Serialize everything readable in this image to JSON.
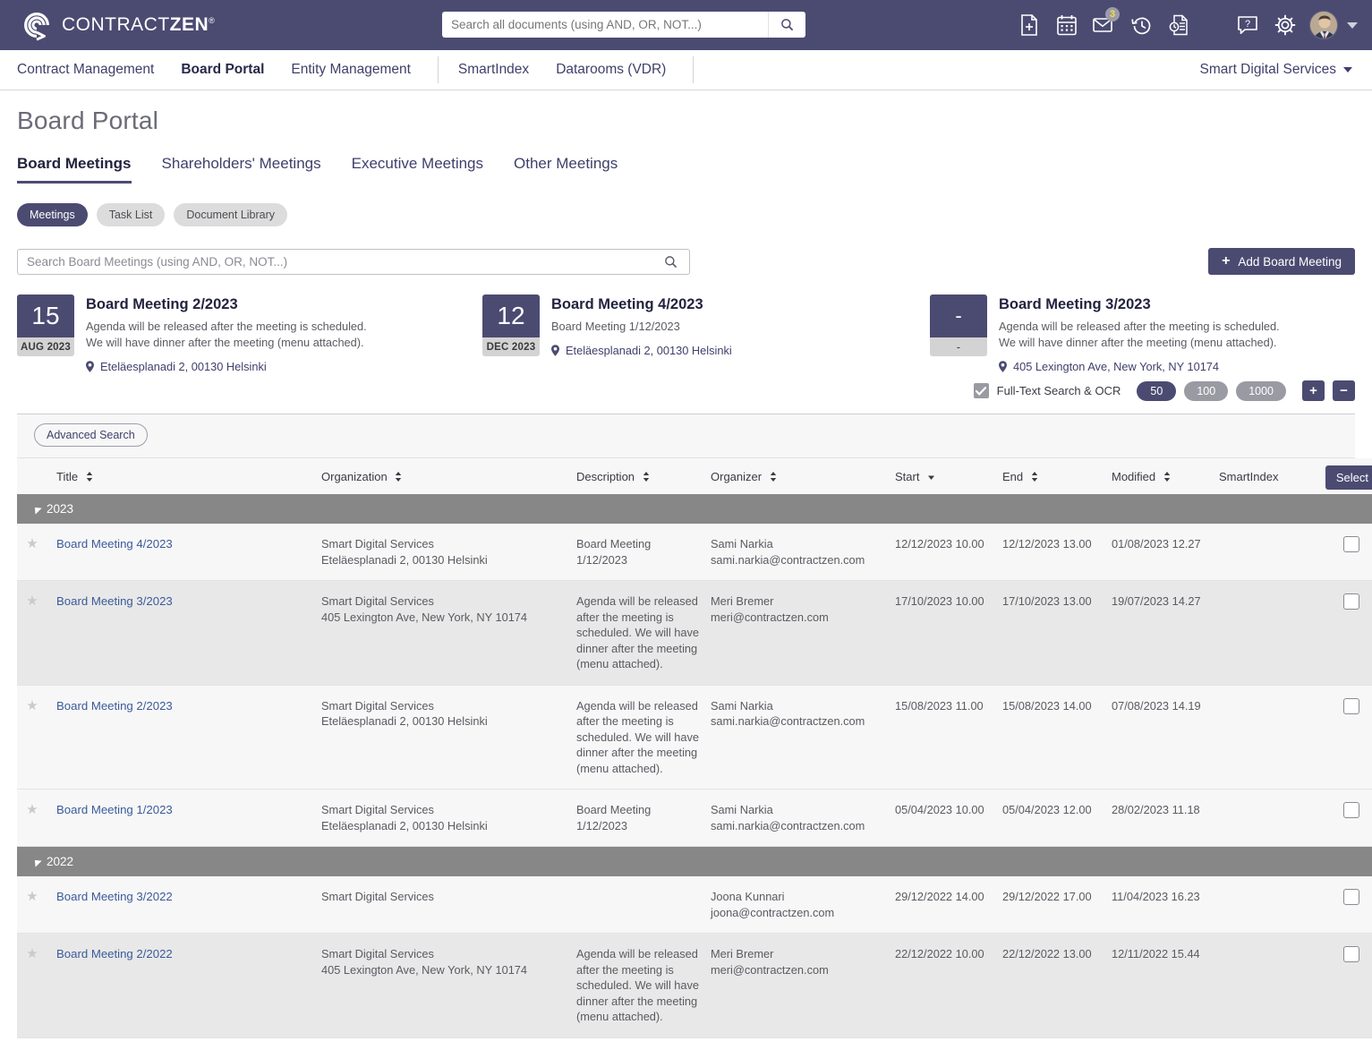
{
  "topbar": {
    "brand": "CONTRACT",
    "brand_bold": "ZEN",
    "brand_mark": "®",
    "search_placeholder": "Search all documents (using AND, OR, NOT...)",
    "search_value": "",
    "mail_badge": "3",
    "icons": [
      "add-document-icon",
      "calendar-icon",
      "mail-icon",
      "history-icon",
      "document-history-icon",
      "help-icon",
      "settings-icon",
      "avatar"
    ]
  },
  "nav": {
    "items": [
      {
        "label": "Contract Management",
        "active": false
      },
      {
        "label": "Board Portal",
        "active": true
      },
      {
        "label": "Entity Management",
        "active": false
      },
      {
        "label": "SmartIndex",
        "active": false
      },
      {
        "label": "Datarooms (VDR)",
        "active": false
      }
    ],
    "organization": "Smart Digital Services"
  },
  "page": {
    "title": "Board Portal",
    "tabs": [
      {
        "label": "Board Meetings",
        "active": true
      },
      {
        "label": "Shareholders' Meetings",
        "active": false
      },
      {
        "label": "Executive Meetings",
        "active": false
      },
      {
        "label": "Other Meetings",
        "active": false
      }
    ],
    "pills": [
      {
        "label": "Meetings",
        "active": true
      },
      {
        "label": "Task List",
        "active": false
      },
      {
        "label": "Document Library",
        "active": false
      }
    ],
    "search_placeholder": "Search Board Meetings (using AND, OR, NOT...)",
    "search_value": "",
    "add_button": "Add Board Meeting",
    "advanced_search": "Advanced Search"
  },
  "cards": [
    {
      "day": "15",
      "month_year": "AUG 2023",
      "title": "Board Meeting 2/2023",
      "description_line1": "Agenda will be released after the meeting is scheduled.",
      "description_line2": "We will have dinner after the meeting (menu attached).",
      "location": "Eteläesplanadi 2, 00130 Helsinki"
    },
    {
      "day": "12",
      "month_year": "DEC 2023",
      "title": "Board Meeting 4/2023",
      "description_line1": "Board Meeting 1/12/2023",
      "description_line2": "",
      "location": "Eteläesplanadi 2, 00130 Helsinki"
    },
    {
      "day": "-",
      "month_year": "-",
      "title": "Board Meeting 3/2023",
      "description_line1": "Agenda will be released after the meeting is scheduled.",
      "description_line2": "We will have dinner after the meeting (menu attached).",
      "location": "405 Lexington Ave, New York, NY 10174"
    }
  ],
  "ocr": {
    "label": "Full-Text Search & OCR",
    "checked": true,
    "counts": [
      {
        "label": "50",
        "active": true
      },
      {
        "label": "100",
        "active": false
      },
      {
        "label": "1000",
        "active": false
      }
    ],
    "plus": "+",
    "minus": "−"
  },
  "table": {
    "select_button": "Select",
    "columns": [
      {
        "label": "Title",
        "sort": "both"
      },
      {
        "label": "Organization",
        "sort": "both"
      },
      {
        "label": "Description",
        "sort": "both"
      },
      {
        "label": "Organizer",
        "sort": "both"
      },
      {
        "label": "Start",
        "sort": "desc"
      },
      {
        "label": "End",
        "sort": "both"
      },
      {
        "label": "Modified",
        "sort": "both"
      },
      {
        "label": "SmartIndex",
        "sort": "none"
      }
    ],
    "groups": [
      {
        "year": "2023",
        "rows": [
          {
            "title": "Board Meeting 4/2023",
            "organization": "Smart Digital Services",
            "organization_address": "Eteläesplanadi 2, 00130 Helsinki",
            "description": "Board Meeting 1/12/2023",
            "organizer": "Sami Narkia",
            "organizer_email": "sami.narkia@contractzen.com",
            "start": "12/12/2023 10.00",
            "end": "12/12/2023 13.00",
            "modified": "01/08/2023 12.27",
            "smartindex": ""
          },
          {
            "title": "Board Meeting 3/2023",
            "organization": "Smart Digital Services",
            "organization_address": "405 Lexington Ave, New York, NY 10174",
            "description": "Agenda will be released after the meeting is scheduled. We will have dinner after the meeting (menu attached).",
            "organizer": "Meri Bremer",
            "organizer_email": "meri@contractzen.com",
            "start": "17/10/2023 10.00",
            "end": "17/10/2023 13.00",
            "modified": "19/07/2023 14.27",
            "smartindex": ""
          },
          {
            "title": "Board Meeting 2/2023",
            "organization": "Smart Digital Services",
            "organization_address": "Eteläesplanadi 2, 00130 Helsinki",
            "description": "Agenda will be released after the meeting is scheduled. We will have dinner after the meeting (menu attached).",
            "organizer": "Sami Narkia",
            "organizer_email": "sami.narkia@contractzen.com",
            "start": "15/08/2023 11.00",
            "end": "15/08/2023 14.00",
            "modified": "07/08/2023 14.19",
            "smartindex": ""
          },
          {
            "title": "Board Meeting 1/2023",
            "organization": "Smart Digital Services",
            "organization_address": "Eteläesplanadi 2, 00130 Helsinki",
            "description": "Board Meeting 1/12/2023",
            "organizer": "Sami Narkia",
            "organizer_email": "sami.narkia@contractzen.com",
            "start": "05/04/2023 10.00",
            "end": "05/04/2023 12.00",
            "modified": "28/02/2023 11.18",
            "smartindex": ""
          }
        ]
      },
      {
        "year": "2022",
        "rows": [
          {
            "title": "Board Meeting 3/2022",
            "organization": "Smart Digital Services",
            "organization_address": "",
            "description": "",
            "organizer": "Joona Kunnari",
            "organizer_email": "joona@contractzen.com",
            "start": "29/12/2022 14.00",
            "end": "29/12/2022 17.00",
            "modified": "11/04/2023 16.23",
            "smartindex": ""
          },
          {
            "title": "Board Meeting 2/2022",
            "organization": "Smart Digital Services",
            "organization_address": "405 Lexington Ave, New York, NY 10174",
            "description": "Agenda will be released after the meeting is scheduled. We will have dinner after the meeting (menu attached).",
            "organizer": "Meri Bremer",
            "organizer_email": "meri@contractzen.com",
            "start": "22/12/2022 10.00",
            "end": "22/12/2022 13.00",
            "modified": "12/11/2022 15.44",
            "smartindex": ""
          }
        ]
      }
    ]
  },
  "colors": {
    "brand_purple": "#4b4b72",
    "group_gray": "#878787",
    "link_blue": "#3b5a9a"
  }
}
